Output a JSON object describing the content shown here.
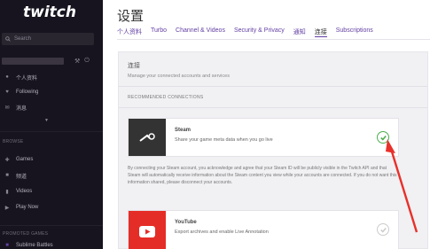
{
  "sidebar": {
    "logo": "twitch",
    "search_placeholder": "Search",
    "items": [
      {
        "icon": "person-icon",
        "label": "个人资料"
      },
      {
        "icon": "heart-icon",
        "label": "Following"
      },
      {
        "icon": "mail-icon",
        "label": "消息"
      }
    ],
    "section_label": "BROWSE",
    "browse_items": [
      {
        "icon": "gamepad-icon",
        "label": "Games"
      },
      {
        "icon": "channels-icon",
        "label": "频道"
      },
      {
        "icon": "video-icon",
        "label": "Videos"
      },
      {
        "icon": "play-icon",
        "label": "Play Now"
      }
    ],
    "promoted_label": "PROMOTED GAMES",
    "promoted_item": "Sublime Battles"
  },
  "header": {
    "title": "设置",
    "tabs": [
      {
        "label": "个人资料",
        "active": false
      },
      {
        "label": "Turbo",
        "active": false
      },
      {
        "label": "Channel & Videos",
        "active": false
      },
      {
        "label": "Security & Privacy",
        "active": false
      },
      {
        "label": "通知",
        "active": false
      },
      {
        "label": "连接",
        "active": true
      },
      {
        "label": "Subscriptions",
        "active": false
      }
    ]
  },
  "connections": {
    "title": "连接",
    "subtitle": "Manage your connected accounts and services",
    "recommended_label": "RECOMMENDED CONNECTIONS",
    "steam": {
      "name": "Steam",
      "description": "Share your game meta data when you go live",
      "connected": true,
      "note": "By connecting your Steam account, you acknowledge and agree that your Steam ID will be publicly visible in the Twitch API and that Steam will automatically receive information about the Steam content you view while your accounts are connected. If you do not want this information shared, please disconnect your accounts."
    },
    "youtube": {
      "name": "YouTube",
      "description": "Export archives and enable Live Annotation",
      "connected": false
    }
  },
  "colors": {
    "sidebar_bg": "#17141f",
    "accent": "#6441a4",
    "connected_green": "#4caf50",
    "youtube_red": "#e52d27",
    "steam_dark": "#333333",
    "annotation_red": "#e8302a"
  }
}
